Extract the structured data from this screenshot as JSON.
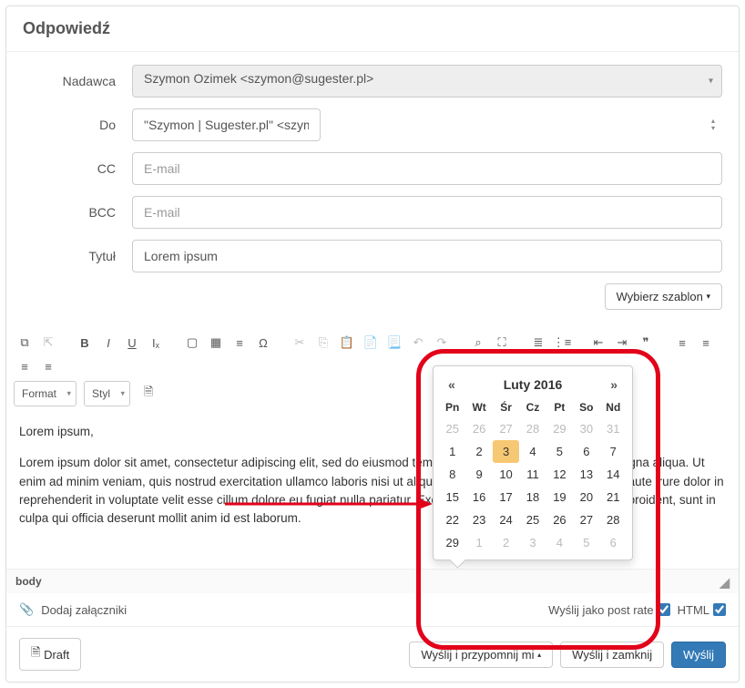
{
  "header": {
    "title": "Odpowiedź"
  },
  "form": {
    "sender_label": "Nadawca",
    "sender_value": "Szymon Ozimek <szymon@sugester.pl>",
    "to_label": "Do",
    "to_value": "\"Szymon | Sugester.pl\" <szymon@sugester.pl>",
    "cc_label": "CC",
    "cc_placeholder": "E-mail",
    "bcc_label": "BCC",
    "bcc_placeholder": "E-mail",
    "subject_label": "Tytuł",
    "subject_value": "Lorem ipsum",
    "template_label": "Wybierz szablon"
  },
  "toolbar": {
    "format_label": "Format",
    "style_label": "Styl"
  },
  "editor": {
    "greeting": "Lorem ipsum,",
    "body": "Lorem ipsum dolor sit amet, consectetur adipiscing elit, sed do eiusmod tempor incididunt ut labore et dolore magna aliqua. Ut enim ad minim veniam, quis nostrud exercitation ullamco laboris nisi ut aliquip ex ea commodo consequat. Duis aute irure dolor in reprehenderit in voluptate velit esse cillum dolore eu fugiat nulla pariatur. Excepteur sint occaecat cupidatat non proident, sunt in culpa qui officia deserunt mollit anim id est laborum."
  },
  "labels": {
    "body": "body",
    "attach": "Dodaj załączniki",
    "post_rate": "Wyślij jako post rate",
    "html": "HTML"
  },
  "footer": {
    "draft": "Draft",
    "send_remind": "Wyślij i przypomnij mi",
    "send_close": "Wyślij i zamknij",
    "send": "Wyślij"
  },
  "calendar": {
    "title": "Luty 2016",
    "prev": "«",
    "next": "»",
    "dow": [
      "Pn",
      "Wt",
      "Śr",
      "Cz",
      "Pt",
      "So",
      "Nd"
    ],
    "weeks": [
      [
        {
          "d": 25,
          "m": true
        },
        {
          "d": 26,
          "m": true
        },
        {
          "d": 27,
          "m": true
        },
        {
          "d": 28,
          "m": true
        },
        {
          "d": 29,
          "m": true
        },
        {
          "d": 30,
          "m": true
        },
        {
          "d": 31,
          "m": true
        }
      ],
      [
        {
          "d": 1
        },
        {
          "d": 2
        },
        {
          "d": 3,
          "sel": true
        },
        {
          "d": 4
        },
        {
          "d": 5
        },
        {
          "d": 6
        },
        {
          "d": 7
        }
      ],
      [
        {
          "d": 8
        },
        {
          "d": 9
        },
        {
          "d": 10
        },
        {
          "d": 11
        },
        {
          "d": 12
        },
        {
          "d": 13
        },
        {
          "d": 14
        }
      ],
      [
        {
          "d": 15
        },
        {
          "d": 16
        },
        {
          "d": 17
        },
        {
          "d": 18
        },
        {
          "d": 19
        },
        {
          "d": 20
        },
        {
          "d": 21
        }
      ],
      [
        {
          "d": 22
        },
        {
          "d": 23
        },
        {
          "d": 24
        },
        {
          "d": 25
        },
        {
          "d": 26
        },
        {
          "d": 27
        },
        {
          "d": 28
        }
      ],
      [
        {
          "d": 29
        },
        {
          "d": 1,
          "m": true
        },
        {
          "d": 2,
          "m": true
        },
        {
          "d": 3,
          "m": true
        },
        {
          "d": 4,
          "m": true
        },
        {
          "d": 5,
          "m": true
        },
        {
          "d": 6,
          "m": true
        }
      ]
    ]
  },
  "icons": {
    "source": "⧉",
    "linkoff": "⇱",
    "bold": "B",
    "italic": "I",
    "underline": "U",
    "strike": "Iₓ",
    "image": "▢",
    "table": "▦",
    "hr": "≡",
    "omega": "Ω",
    "cut": "✂",
    "copy": "⎘",
    "paste": "📋",
    "paste2": "📄",
    "paste3": "📃",
    "undo": "↶",
    "redo": "↷",
    "find": "⌕",
    "expand": "⛶",
    "ol": "≣",
    "ul": "⋮≡",
    "outdent": "⇤",
    "indent": "⇥",
    "quote": "❞",
    "left": "≡",
    "center": "≡",
    "right": "≡",
    "just": "≡",
    "attach": "📎",
    "save": "🗎"
  }
}
